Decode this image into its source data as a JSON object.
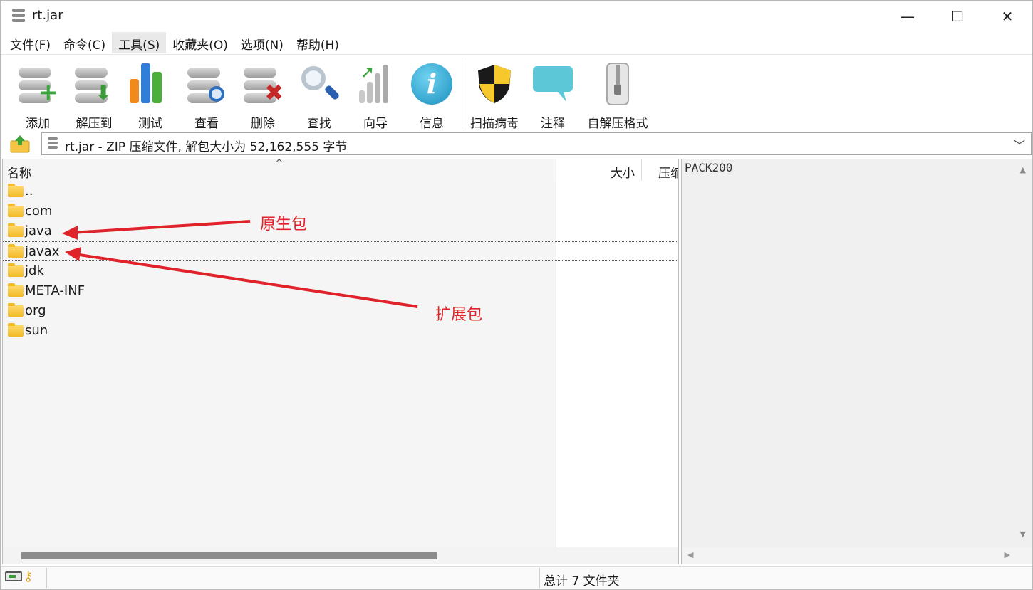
{
  "window": {
    "title": "rt.jar",
    "minimize": "—",
    "maximize": "☐",
    "close": "✕"
  },
  "menu": [
    "文件(F)",
    "命令(C)",
    "工具(S)",
    "收藏夹(O)",
    "选项(N)",
    "帮助(H)"
  ],
  "toolbar": [
    {
      "label": "添加",
      "icon": "add-archive-icon"
    },
    {
      "label": "解压到",
      "icon": "extract-icon"
    },
    {
      "label": "测试",
      "icon": "test-chart-icon"
    },
    {
      "label": "查看",
      "icon": "view-icon"
    },
    {
      "label": "删除",
      "icon": "delete-icon"
    },
    {
      "label": "查找",
      "icon": "find-magnifier-icon"
    },
    {
      "label": "向导",
      "icon": "wizard-icon"
    },
    {
      "label": "信息",
      "icon": "info-icon"
    },
    {
      "label": "扫描病毒",
      "icon": "shield-icon"
    },
    {
      "label": "注释",
      "icon": "comment-bubble-icon"
    },
    {
      "label": "自解压格式",
      "icon": "sfx-zip-icon"
    }
  ],
  "address": {
    "text": "rt.jar - ZIP 压缩文件, 解包大小为 52,162,555 字节",
    "dropdown": "﹀"
  },
  "filelist": {
    "columns": {
      "name": "名称",
      "size": "大小",
      "compressed": "压缩"
    },
    "sort_indicator": "^",
    "rows": [
      "..",
      "com",
      "java",
      "javax",
      "jdk",
      "META-INF",
      "org",
      "sun"
    ],
    "focused_row": "javax"
  },
  "comment": {
    "text": "PACK200"
  },
  "status": {
    "summary": "总计 7 文件夹"
  },
  "annotations": {
    "native": "原生包",
    "extension": "扩展包",
    "color": "#e0232a"
  }
}
